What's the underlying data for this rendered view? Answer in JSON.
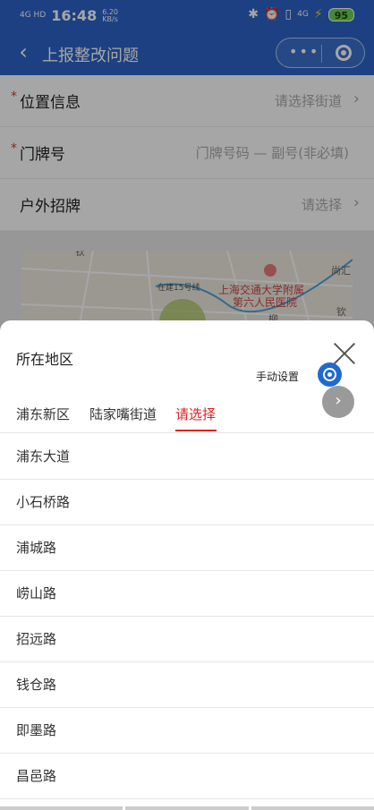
{
  "status": {
    "network": "4G HD",
    "time": "16:48",
    "speed_value": "6.20",
    "speed_unit": "KB/s",
    "net_right": "4G",
    "battery": "95"
  },
  "nav": {
    "title": "上报整改问题",
    "more": "•••"
  },
  "form": {
    "location": {
      "label": "位置信息",
      "placeholder": "请选择街道"
    },
    "door": {
      "label": "门牌号",
      "placeholder": "门牌号码 — 副号(非必填)"
    },
    "sign": {
      "label": "户外招牌",
      "placeholder": "请选择"
    }
  },
  "map": {
    "labels": [
      "钦",
      "在建15号线",
      "上海交通大学附属",
      "第六人民医院",
      "尚汇",
      "钦",
      "柳"
    ]
  },
  "sheet": {
    "title": "所在地区",
    "manual_label": "手动设置",
    "tabs": [
      "浦东新区",
      "陆家嘴街道",
      "请选择"
    ],
    "items": [
      "浦东大道",
      "小石桥路",
      "浦城路",
      "崂山路",
      "招远路",
      "钱仓路",
      "即墨路",
      "昌邑路"
    ]
  },
  "colors": {
    "primary": "#2b63c8",
    "accent": "#d22222",
    "required": "#dd3333"
  },
  "icons": [
    "back-icon",
    "more-icon",
    "record-icon",
    "chevron-right-icon",
    "close-icon",
    "locate-icon"
  ]
}
